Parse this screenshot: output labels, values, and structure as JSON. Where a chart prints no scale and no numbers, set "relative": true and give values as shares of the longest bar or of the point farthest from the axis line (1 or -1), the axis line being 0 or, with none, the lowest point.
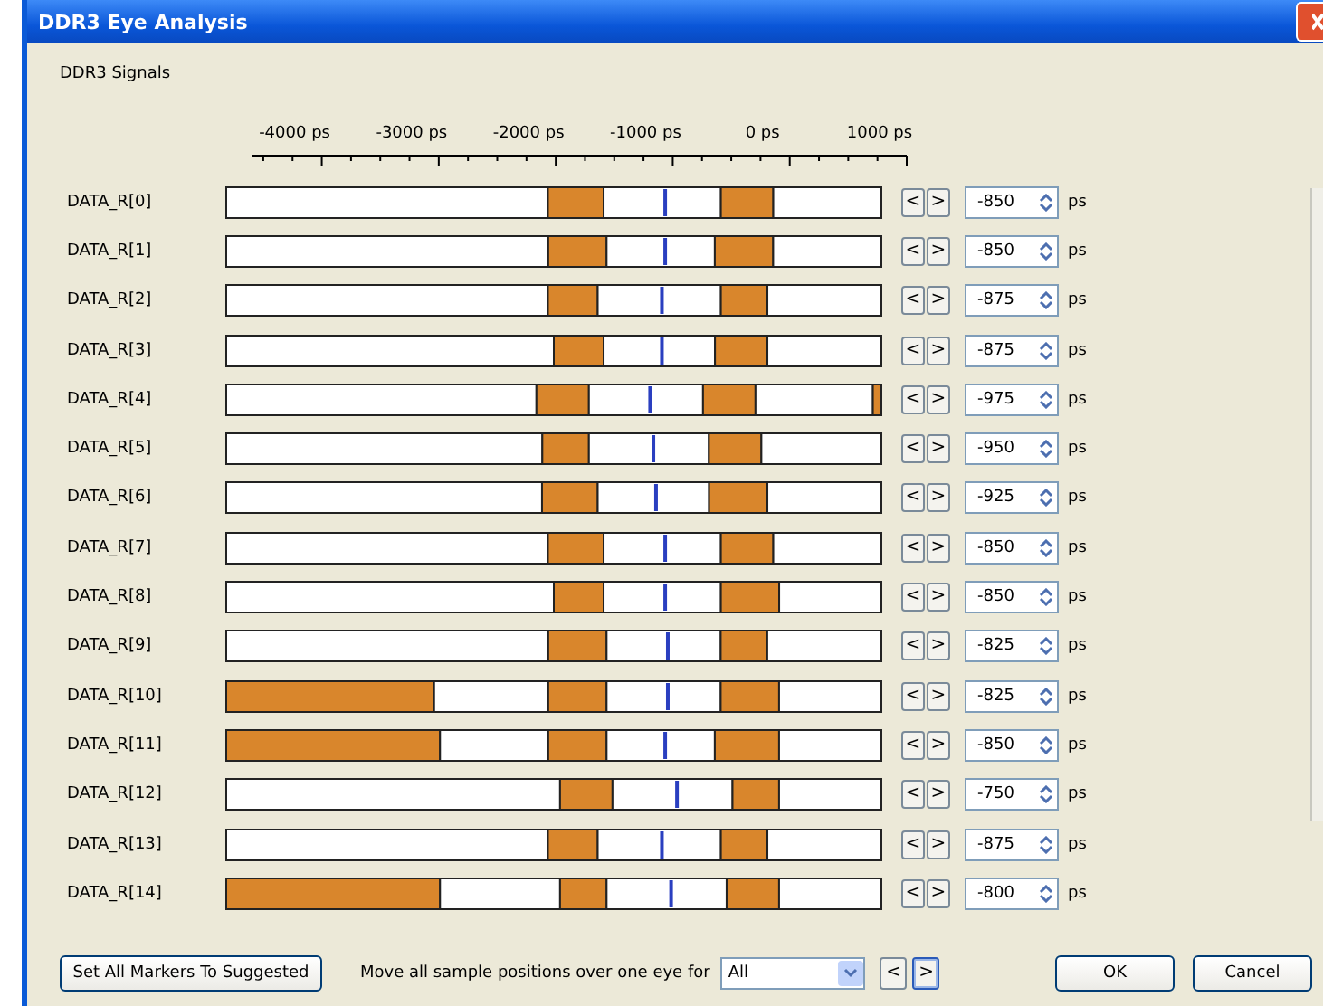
{
  "window": {
    "title": "DDR3 Eye Analysis"
  },
  "group_label": "DDR3 Signals",
  "eye_chart": {
    "axis_labels": [
      "-4000 ps",
      "-3000 ps",
      "-2000 ps",
      "-1000 ps",
      "0 ps",
      "1000 ps"
    ],
    "chart_data": {
      "type": "bar",
      "orientation": "horizontal",
      "stacked": true,
      "relative": true,
      "categories": [
        "DATA_R[0]",
        "DATA_R[1]",
        "DATA_R[2]",
        "DATA_R[3]",
        "DATA_R[4]",
        "DATA_R[5]",
        "DATA_R[6]",
        "DATA_R[7]",
        "DATA_R[8]",
        "DATA_R[9]",
        "DATA_R[10]",
        "DATA_R[11]",
        "DATA_R[12]",
        "DATA_R[13]",
        "DATA_R[14]"
      ],
      "series": [
        {
          "color": "#d9862c",
          "values": [
            0,
            0,
            0,
            0,
            0,
            0,
            0,
            0,
            0,
            0,
            0.317,
            0.326,
            0,
            0,
            0.326
          ]
        },
        {
          "color": "#ffffff",
          "values": [
            0.491,
            0.491,
            0.491,
            0.5,
            0.473,
            0.482,
            0.482,
            0.491,
            0.5,
            0.491,
            0.174,
            0.165,
            0.509,
            0.491,
            0.183
          ]
        },
        {
          "color": "#d9862c",
          "values": [
            0.085,
            0.089,
            0.076,
            0.076,
            0.08,
            0.071,
            0.085,
            0.085,
            0.076,
            0.089,
            0.089,
            0.089,
            0.08,
            0.076,
            0.071
          ]
        },
        {
          "color": "#ffffff",
          "values": [
            0.179,
            0.165,
            0.188,
            0.17,
            0.174,
            0.183,
            0.17,
            0.179,
            0.179,
            0.174,
            0.174,
            0.165,
            0.183,
            0.188,
            0.183
          ]
        },
        {
          "color": "#d9862c",
          "values": [
            0.08,
            0.089,
            0.071,
            0.08,
            0.08,
            0.08,
            0.089,
            0.08,
            0.089,
            0.071,
            0.089,
            0.098,
            0.071,
            0.071,
            0.08
          ]
        },
        {
          "color": "#ffffff",
          "values": [
            0.165,
            0.165,
            0.174,
            0.174,
            0.179,
            0.183,
            0.174,
            0.165,
            0.156,
            0.174,
            0.156,
            0.156,
            0.156,
            0.174,
            0.156
          ]
        },
        {
          "color": "#d9862c",
          "values": [
            0,
            0,
            0,
            0,
            0.013,
            0,
            0,
            0,
            0,
            0,
            0,
            0,
            0,
            0,
            0
          ]
        }
      ]
    }
  },
  "signals": [
    {
      "level": 0.67,
      "prev": "<",
      "next": ">",
      "sample": "-850",
      "unit": "ps"
    },
    {
      "level": 0.67,
      "prev": "<",
      "next": ">",
      "sample": "-850",
      "unit": "ps"
    },
    {
      "level": 0.665,
      "prev": "<",
      "next": ">",
      "sample": "-875",
      "unit": "ps"
    },
    {
      "level": 0.665,
      "prev": "<",
      "next": ">",
      "sample": "-875",
      "unit": "ps"
    },
    {
      "level": 0.647,
      "prev": "<",
      "next": ">",
      "sample": "-975",
      "unit": "ps"
    },
    {
      "level": 0.652,
      "prev": "<",
      "next": ">",
      "sample": "-950",
      "unit": "ps"
    },
    {
      "level": 0.656,
      "prev": "<",
      "next": ">",
      "sample": "-925",
      "unit": "ps"
    },
    {
      "level": 0.67,
      "prev": "<",
      "next": ">",
      "sample": "-850",
      "unit": "ps"
    },
    {
      "level": 0.67,
      "prev": "<",
      "next": ">",
      "sample": "-850",
      "unit": "ps"
    },
    {
      "level": 0.674,
      "prev": "<",
      "next": ">",
      "sample": "-825",
      "unit": "ps"
    },
    {
      "level": 0.674,
      "prev": "<",
      "next": ">",
      "sample": "-825",
      "unit": "ps"
    },
    {
      "level": 0.67,
      "prev": "<",
      "next": ">",
      "sample": "-850",
      "unit": "ps"
    },
    {
      "level": 0.688,
      "prev": "<",
      "next": ">",
      "sample": "-750",
      "unit": "ps"
    },
    {
      "level": 0.665,
      "prev": "<",
      "next": ">",
      "sample": "-875",
      "unit": "ps"
    },
    {
      "level": 0.679,
      "prev": "<",
      "next": ">",
      "sample": "-800",
      "unit": "ps"
    }
  ],
  "footer": {
    "suggest_button": "Set All Markers To Suggested",
    "move_label": "Move all sample positions over one eye for",
    "scope_select": "All",
    "shift_buttons": [
      {
        "label": "<",
        "selected": false
      },
      {
        "label": ">",
        "selected": true
      }
    ],
    "ok_button": "OK",
    "cancel_button": "Cancel"
  }
}
